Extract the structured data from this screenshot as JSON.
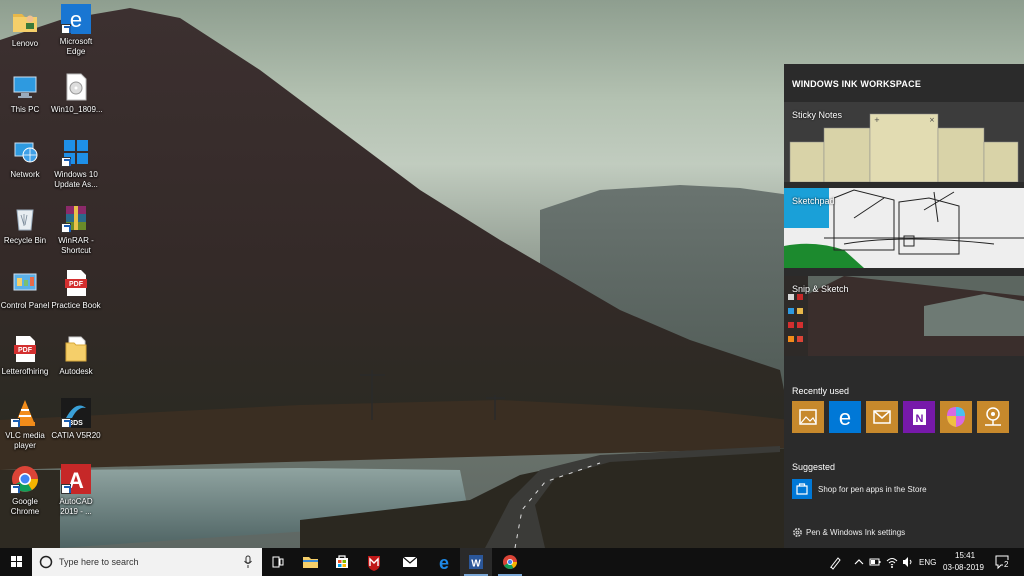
{
  "desktop": {
    "icons": [
      {
        "label": "Lenovo"
      },
      {
        "label": "Microsoft Edge"
      },
      {
        "label": "This PC"
      },
      {
        "label": "Win10_1809..."
      },
      {
        "label": "Network"
      },
      {
        "label": "Windows 10 Update As..."
      },
      {
        "label": "Recycle Bin"
      },
      {
        "label": "WinRAR - Shortcut"
      },
      {
        "label": "Control Panel"
      },
      {
        "label": "Practice Book"
      },
      {
        "label": "Letterofhiring"
      },
      {
        "label": "Autodesk"
      },
      {
        "label": "VLC media player"
      },
      {
        "label": "CATIA V5R20"
      },
      {
        "label": "Google Chrome"
      },
      {
        "label": "AutoCAD 2019 - ..."
      }
    ]
  },
  "ink_workspace": {
    "title": "WINDOWS INK WORKSPACE",
    "tiles": [
      {
        "label": "Sticky Notes"
      },
      {
        "label": "Sketchpad"
      },
      {
        "label": "Snip & Sketch"
      }
    ],
    "recently_used_heading": "Recently used",
    "recent_apps": [
      "photos-icon",
      "edge-icon",
      "mail-icon",
      "onenote-icon",
      "paint3d-icon",
      "maps-icon"
    ],
    "suggested_heading": "Suggested",
    "suggested_link": "Shop for pen apps in the Store",
    "settings_link": "Pen & Windows Ink settings"
  },
  "taskbar": {
    "search_placeholder": "Type here to search",
    "pinned_apps": [
      "task-view-icon",
      "file-explorer-icon",
      "store-icon",
      "mcafee-icon",
      "mail-icon",
      "edge-icon",
      "word-icon",
      "chrome-icon"
    ],
    "language": "ENG",
    "time": "15:41",
    "date": "03-08-2019",
    "notification_count": "2"
  },
  "colors": {
    "panel_bg": "#2b2b2b",
    "taskbar_bg": "#101010",
    "accent_blue": "#0078d7",
    "app_tile_orange": "#c7892c",
    "onenote_purple": "#7719aa"
  }
}
